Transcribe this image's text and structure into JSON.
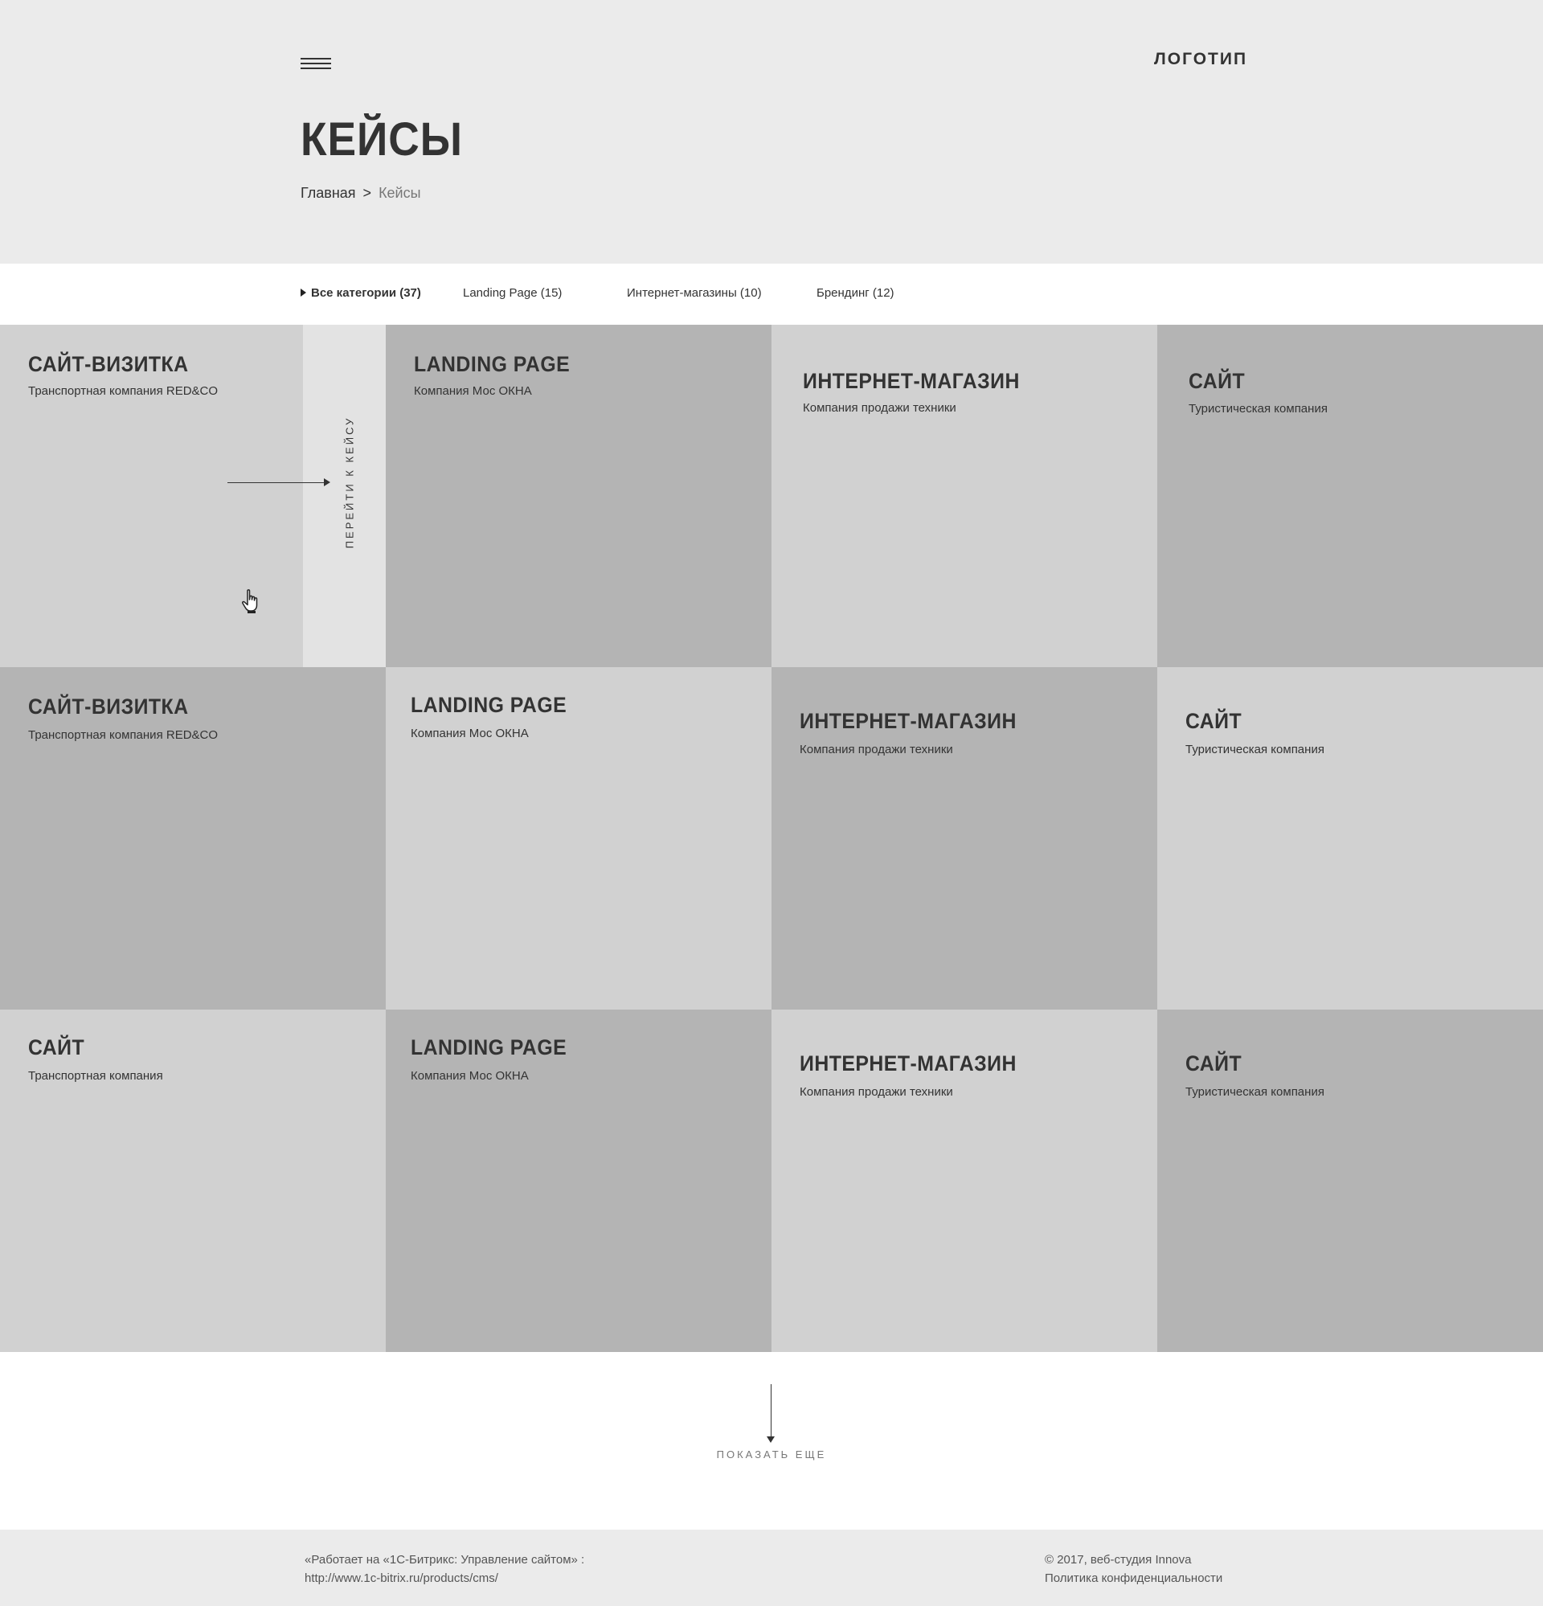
{
  "header": {
    "logo": "ЛОГОТИП",
    "title": "КЕЙСЫ",
    "breadcrumb": {
      "home": "Главная",
      "separator": ">",
      "current": "Кейсы"
    }
  },
  "filters": [
    {
      "label": "Все категории (37)",
      "active": true
    },
    {
      "label": "Landing Page (15)",
      "active": false
    },
    {
      "label": "Интернет-магазины (10)",
      "active": false
    },
    {
      "label": "Брендинг (12)",
      "active": false
    }
  ],
  "cases": [
    {
      "title": "САЙТ-ВИЗИТКА",
      "subtitle": "Транспортная компания RED&CO"
    },
    {
      "title": "LANDING PAGE",
      "subtitle": "Компания Мос ОКНА"
    },
    {
      "title": "ИНТЕРНЕТ-МАГАЗИН",
      "subtitle": "Компания продажи техники"
    },
    {
      "title": "САЙТ",
      "subtitle": "Туристическая компания"
    },
    {
      "title": "САЙТ-ВИЗИТКА",
      "subtitle": "Транспортная компания RED&CO"
    },
    {
      "title": "LANDING PAGE",
      "subtitle": "Компания Мос ОКНА"
    },
    {
      "title": "ИНТЕРНЕТ-МАГАЗИН",
      "subtitle": "Компания продажи техники"
    },
    {
      "title": "САЙТ",
      "subtitle": "Туристическая компания"
    },
    {
      "title": "САЙТ",
      "subtitle": "Транспортная компания"
    },
    {
      "title": "LANDING PAGE",
      "subtitle": "Компания Мос ОКНА"
    },
    {
      "title": "ИНТЕРНЕТ-МАГАЗИН",
      "subtitle": "Компания продажи техники"
    },
    {
      "title": "САЙТ",
      "subtitle": "Туристическая компания"
    }
  ],
  "hover": {
    "label": "ПЕРЕЙТИ К КЕЙСУ"
  },
  "show_more": "ПОКАЗАТЬ ЕЩЕ",
  "footer": {
    "powered_line1": "«Работает на «1С-Битрикс: Управление сайтом» :",
    "powered_line2": "http://www.1c-bitrix.ru/products/cms/",
    "copyright": "© 2017, веб-студия Innova",
    "privacy": "Политика конфиденциальности"
  },
  "colors": {
    "header_bg": "#ebebeb",
    "tile_light": "#d1d1d1",
    "tile_dark": "#b4b4b4",
    "hover_panel": "#e3e3e3",
    "text": "#333333"
  }
}
